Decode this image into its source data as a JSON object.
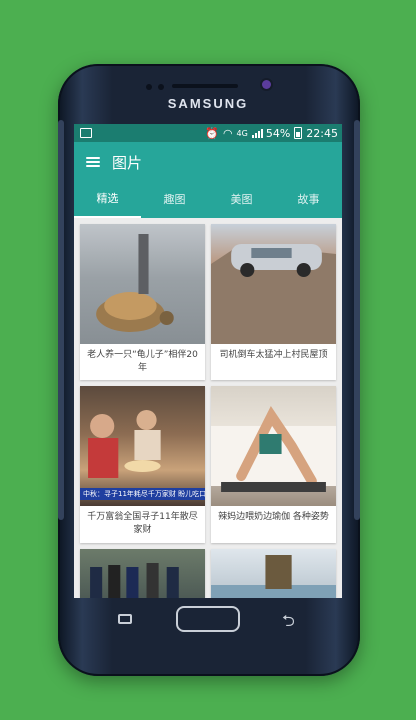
{
  "device": {
    "brand": "SAMSUNG"
  },
  "statusbar": {
    "network": "4G",
    "battery": "54%",
    "time": "22:45"
  },
  "appbar": {
    "title": "图片"
  },
  "tabs": [
    {
      "label": "精选",
      "active": true
    },
    {
      "label": "趣图",
      "active": false
    },
    {
      "label": "美图",
      "active": false
    },
    {
      "label": "故事",
      "active": false
    }
  ],
  "cards": [
    {
      "caption": "老人养一只“龟儿子”相伴20年"
    },
    {
      "caption": "司机倒车太猛冲上村民屋顶"
    },
    {
      "caption": "千万富翁全国寻子11年散尽家财",
      "ticker": "中秋：寻子11年耗尽千万家财 盼儿吃口蛋糕"
    },
    {
      "caption": "辣妈边喂奶边瑜伽 各种姿势"
    },
    {
      "caption": ""
    },
    {
      "caption": ""
    }
  ],
  "colors": {
    "primary": "#26a69a",
    "primary_dark": "#1b7d70",
    "background": "#4caf50"
  }
}
